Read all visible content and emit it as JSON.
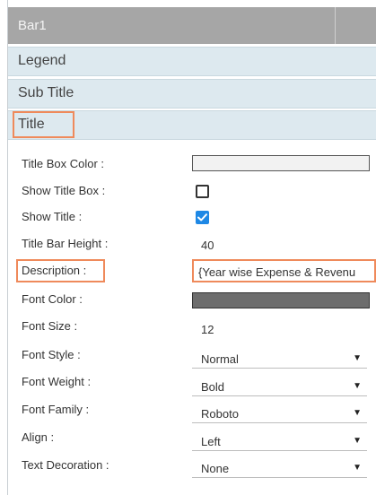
{
  "window": {
    "title": "Bar1"
  },
  "sections": {
    "legend": "Legend",
    "subtitle": "Sub Title",
    "title": "Title"
  },
  "properties": {
    "title_box_color": {
      "label": "Title Box Color :",
      "color": "#f2f2f2"
    },
    "show_title_box": {
      "label": "Show Title Box :",
      "checked": false
    },
    "show_title": {
      "label": "Show Title :",
      "checked": true
    },
    "title_bar_height": {
      "label": "Title Bar Height :",
      "value": "40"
    },
    "description": {
      "label": "Description :",
      "value": "{Year wise Expense & Revenu"
    },
    "font_color": {
      "label": "Font Color :",
      "color": "#6d6d6d"
    },
    "font_size": {
      "label": "Font Size :",
      "value": "12"
    },
    "font_style": {
      "label": "Font Style :",
      "value": "Normal"
    },
    "font_weight": {
      "label": "Font Weight :",
      "value": "Bold"
    },
    "font_family": {
      "label": "Font Family :",
      "value": "Roboto"
    },
    "align": {
      "label": "Align :",
      "value": "Left"
    },
    "text_decoration": {
      "label": "Text Decoration :",
      "value": "None"
    }
  },
  "icons": {
    "dropdown": "dropdown-arrow-icon",
    "check": "checkmark-icon"
  },
  "colors": {
    "highlight": "#ef8a5b",
    "checkbox_checked": "#1e88e5",
    "section_bg": "#dde9ef",
    "titlebar_bg": "#a6a6a6"
  }
}
